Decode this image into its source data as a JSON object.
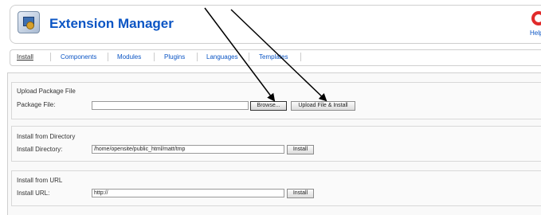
{
  "header": {
    "title": "Extension Manager",
    "help_label": "Help"
  },
  "tabs": [
    {
      "label": "Install",
      "active": true
    },
    {
      "label": "Components"
    },
    {
      "label": "Modules"
    },
    {
      "label": "Plugins"
    },
    {
      "label": "Languages"
    },
    {
      "label": "Templates"
    }
  ],
  "upload": {
    "legend": "Upload Package File",
    "field_label": "Package File:",
    "value": "",
    "browse_label": "Browse...",
    "submit_label": "Upload File & Install"
  },
  "directory": {
    "legend": "Install from Directory",
    "field_label": "Install Directory:",
    "value": "/home/opensite/public_html/matt/tmp",
    "submit_label": "Install"
  },
  "url": {
    "legend": "Install from URL",
    "field_label": "Install URL:",
    "value": "http://",
    "submit_label": "Install"
  },
  "colors": {
    "title_blue": "#0b55c4",
    "help_red": "#e12b2b",
    "annotation_arrow": "#000000"
  }
}
